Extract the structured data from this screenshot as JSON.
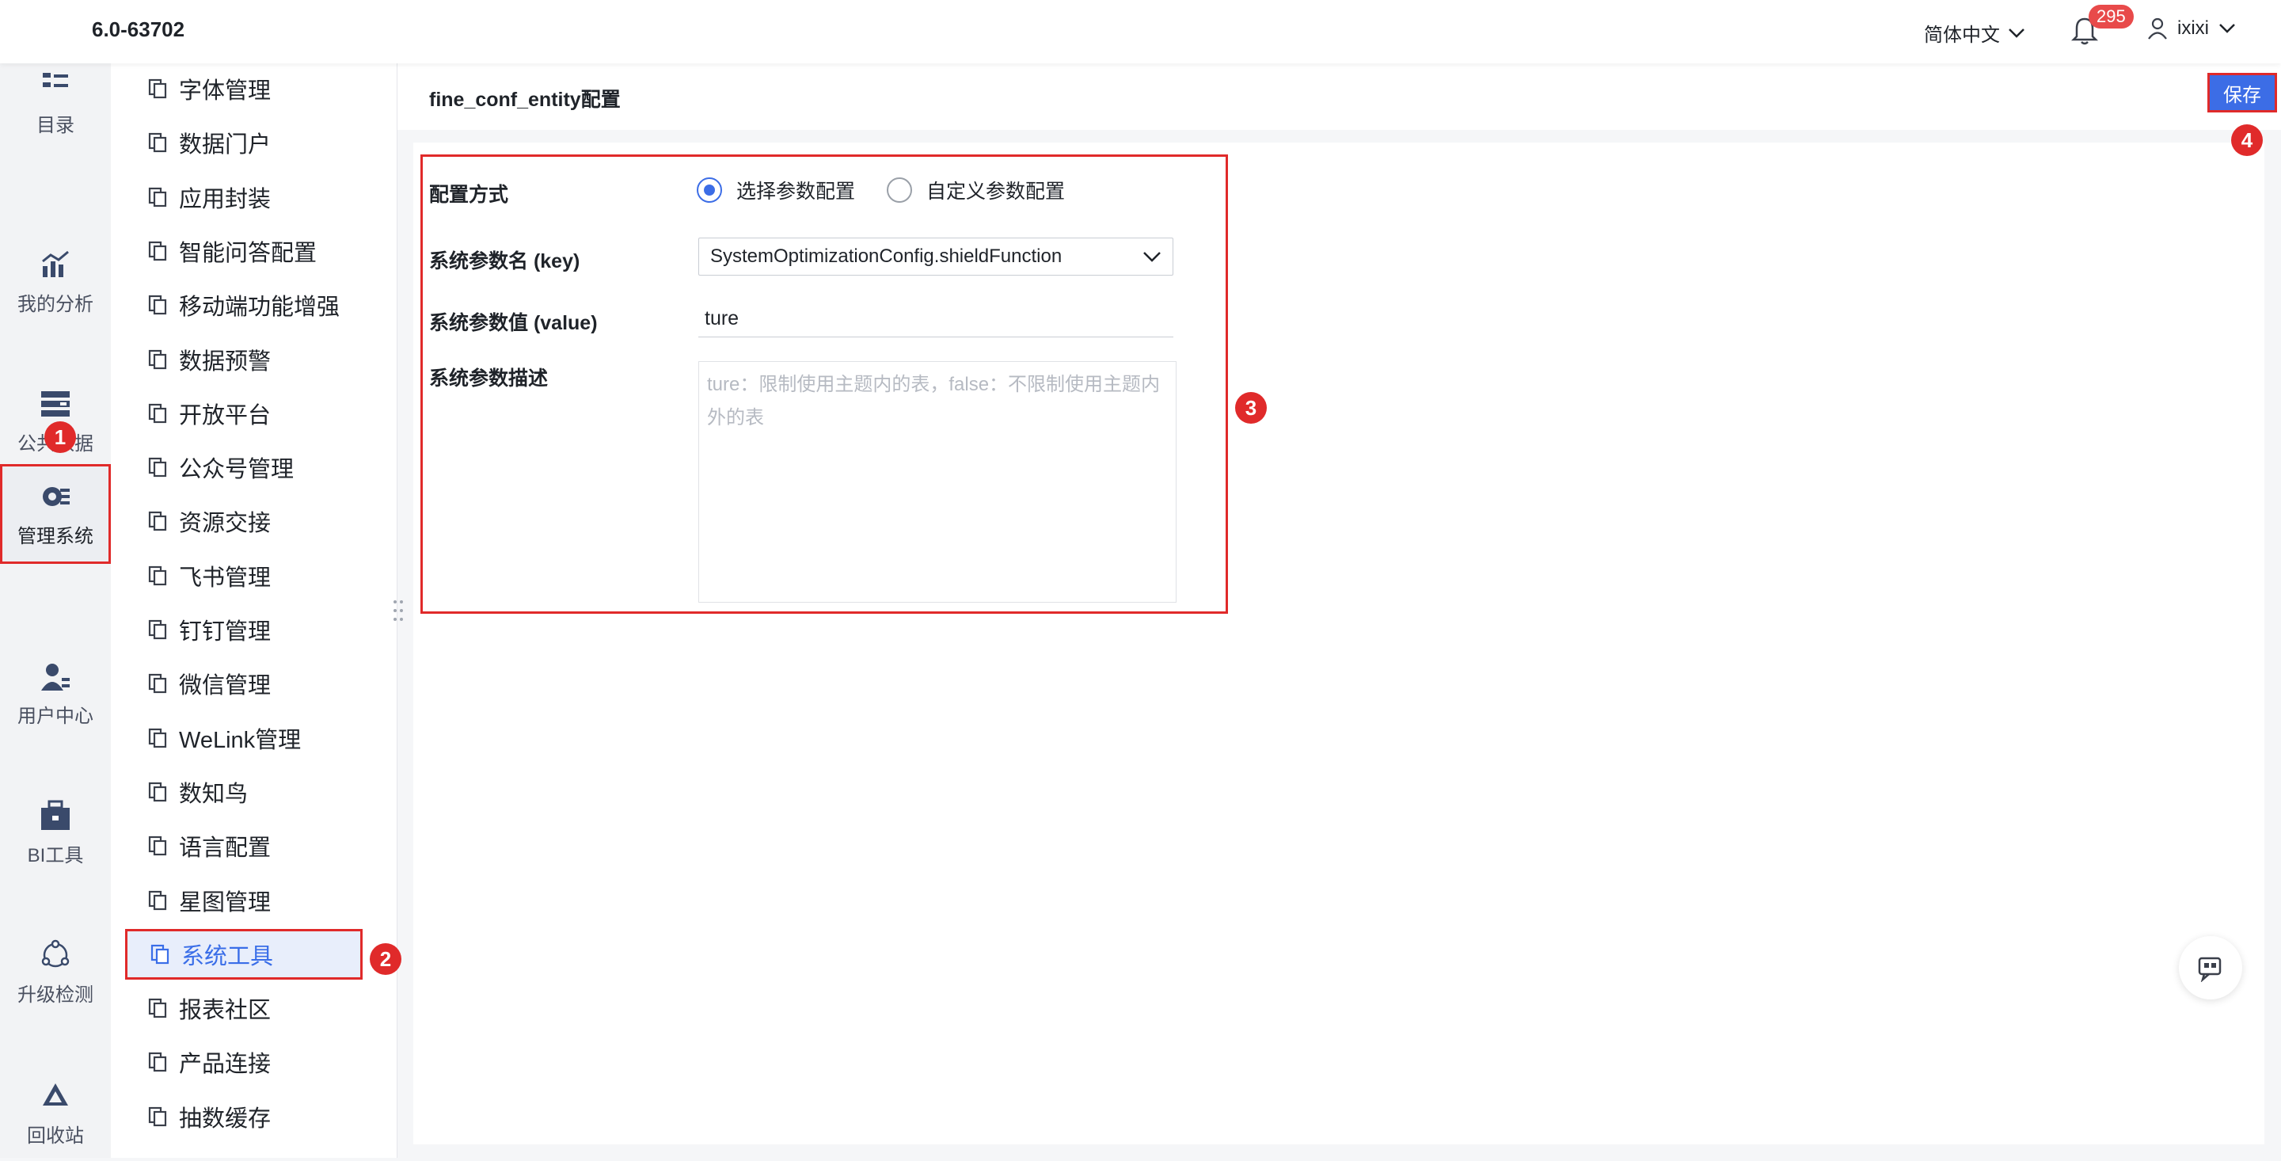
{
  "topbar": {
    "version": "6.0-63702",
    "language": "简体中文",
    "notification_count": "295",
    "username": "ixixi"
  },
  "rail": {
    "items": [
      {
        "label": "目录",
        "icon": "catalog-icon"
      },
      {
        "label": "我的分析",
        "icon": "analysis-icon"
      },
      {
        "label": "公共数据",
        "icon": "public-data-icon"
      },
      {
        "label": "管理系统",
        "icon": "manage-system-icon"
      },
      {
        "label": "用户中心",
        "icon": "user-center-icon"
      },
      {
        "label": "BI工具",
        "icon": "bi-tools-icon"
      },
      {
        "label": "升级检测",
        "icon": "upgrade-check-icon"
      },
      {
        "label": "回收站",
        "icon": "recycle-bin-icon"
      }
    ]
  },
  "menu": {
    "items": [
      "字体管理",
      "数据门户",
      "应用封装",
      "智能问答配置",
      "移动端功能增强",
      "数据预警",
      "开放平台",
      "公众号管理",
      "资源交接",
      "飞书管理",
      "钉钉管理",
      "微信管理",
      "WeLink管理",
      "数知鸟",
      "语言配置",
      "星图管理",
      "系统工具",
      "报表社区",
      "产品连接",
      "抽数缓存"
    ],
    "selected": "系统工具"
  },
  "page": {
    "title": "fine_conf_entity配置",
    "save_label": "保存"
  },
  "form": {
    "mode_label": "配置方式",
    "mode_options": [
      "选择参数配置",
      "自定义参数配置"
    ],
    "mode_selected": "选择参数配置",
    "key_label": "系统参数名 (key)",
    "key_value": "SystemOptimizationConfig.shieldFunction",
    "value_label": "系统参数值 (value)",
    "value_value": "ture",
    "desc_label": "系统参数描述",
    "desc_placeholder": "ture：限制使用主题内的表，false：不限制使用主题内外的表"
  },
  "markers": [
    "1",
    "2",
    "3",
    "4"
  ],
  "colors": {
    "accent": "#3c6de6",
    "annotation": "#e02a2a",
    "badge": "#e84a4a"
  }
}
